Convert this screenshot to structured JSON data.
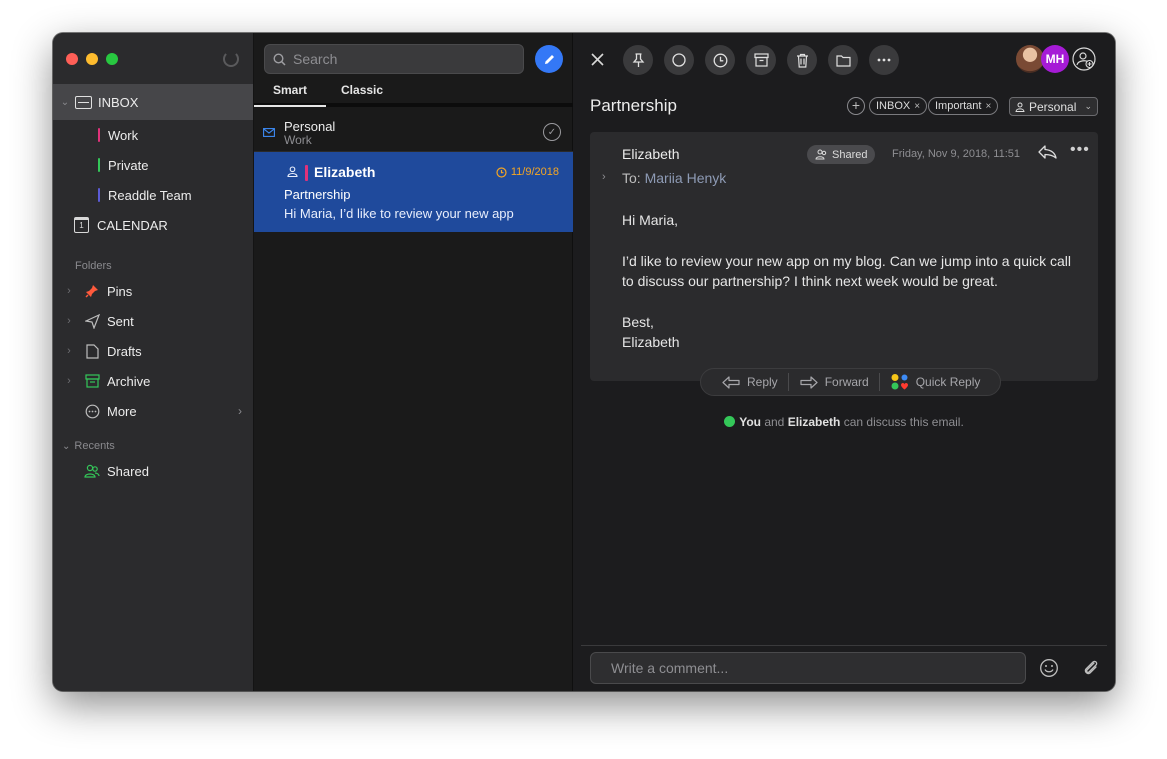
{
  "sidebar": {
    "inbox_label": "INBOX",
    "subfolders": [
      {
        "label": "Work",
        "color": "#e0327a"
      },
      {
        "label": "Private",
        "color": "#34c759"
      },
      {
        "label": "Readdle Team",
        "color": "#5b5bd6"
      }
    ],
    "calendar_label": "CALENDAR",
    "calendar_day": "1",
    "folders_heading": "Folders",
    "folders": [
      {
        "label": "Pins",
        "icon": "pin-icon"
      },
      {
        "label": "Sent",
        "icon": "send-icon"
      },
      {
        "label": "Drafts",
        "icon": "draft-icon"
      },
      {
        "label": "Archive",
        "icon": "archive-icon"
      },
      {
        "label": "More",
        "icon": "more-icon"
      }
    ],
    "recents_heading": "Recents",
    "recents": [
      {
        "label": "Shared",
        "icon": "shared-icon"
      }
    ]
  },
  "list": {
    "search_placeholder": "Search",
    "tabs": [
      "Smart",
      "Classic"
    ],
    "active_tab": "Smart",
    "group": {
      "title": "Personal",
      "subtitle": "Work"
    },
    "message": {
      "sender": "Elizabeth",
      "date": "11/9/2018",
      "subject": "Partnership",
      "preview": "Hi Maria, I’d like to review your new app"
    }
  },
  "reader": {
    "subject": "Partnership",
    "tags": [
      "INBOX",
      "Important"
    ],
    "category": "Personal",
    "avatar_initials": "MH",
    "from": "Elizabeth",
    "shared_label": "Shared",
    "date": "Friday, Nov 9, 2018, 11:51",
    "to_label": "To:",
    "to_name": "Mariia Henyk",
    "body": [
      "Hi Maria,",
      "I’d like to review your new app on my blog. Can we jump into a quick call to discuss our partnership? I think next week would be great.",
      "Best,\nElizabeth"
    ],
    "actions": {
      "reply": "Reply",
      "forward": "Forward",
      "quick_reply": "Quick Reply"
    },
    "discuss": {
      "you": "You",
      "and": "and",
      "person": "Elizabeth",
      "rest": "can discuss this email."
    },
    "comment_placeholder": "Write a comment..."
  },
  "colors": {
    "accent": "#3478f6",
    "selected_row": "#1f4a9c",
    "date_orange": "#f5a623"
  }
}
